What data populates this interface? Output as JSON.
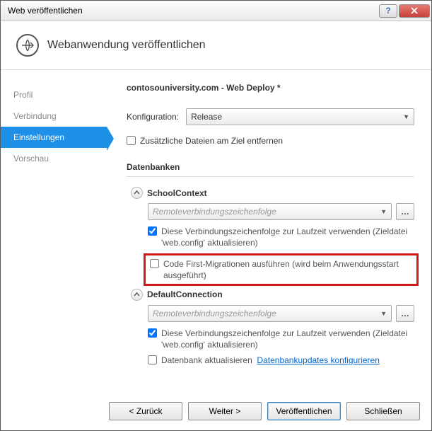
{
  "window": {
    "title": "Web veröffentlichen"
  },
  "header": {
    "title": "Webanwendung veröffentlichen"
  },
  "sidebar": {
    "items": [
      {
        "label": "Profil"
      },
      {
        "label": "Verbindung"
      },
      {
        "label": "Einstellungen"
      },
      {
        "label": "Vorschau"
      }
    ],
    "active_index": 2
  },
  "main": {
    "page_title": "contosouniversity.com - Web Deploy *",
    "config_label": "Konfiguration:",
    "config_value": "Release",
    "remove_extra_label": "Zusätzliche Dateien am Ziel entfernen",
    "databases_heading": "Datenbanken",
    "db": [
      {
        "name": "SchoolContext",
        "conn_placeholder": "Remoteverbindungszeichenfolge",
        "use_conn_label": "Diese Verbindungszeichenfolge zur Laufzeit verwenden (Zieldatei 'web.config' aktualisieren)",
        "use_conn_checked": true,
        "codefirst_label": "Code First-Migrationen ausführen (wird beim Anwendungsstart ausgeführt)",
        "codefirst_checked": false
      },
      {
        "name": "DefaultConnection",
        "conn_placeholder": "Remoteverbindungszeichenfolge",
        "use_conn_label": "Diese Verbindungszeichenfolge zur Laufzeit verwenden (Zieldatei 'web.config' aktualisieren)",
        "use_conn_checked": true,
        "update_db_label": "Datenbank aktualisieren",
        "update_db_checked": false,
        "config_link": "Datenbankupdates konfigurieren"
      }
    ]
  },
  "footer": {
    "back": "<  Zurück",
    "next": "Weiter  >",
    "publish": "Veröffentlichen",
    "close": "Schließen"
  }
}
